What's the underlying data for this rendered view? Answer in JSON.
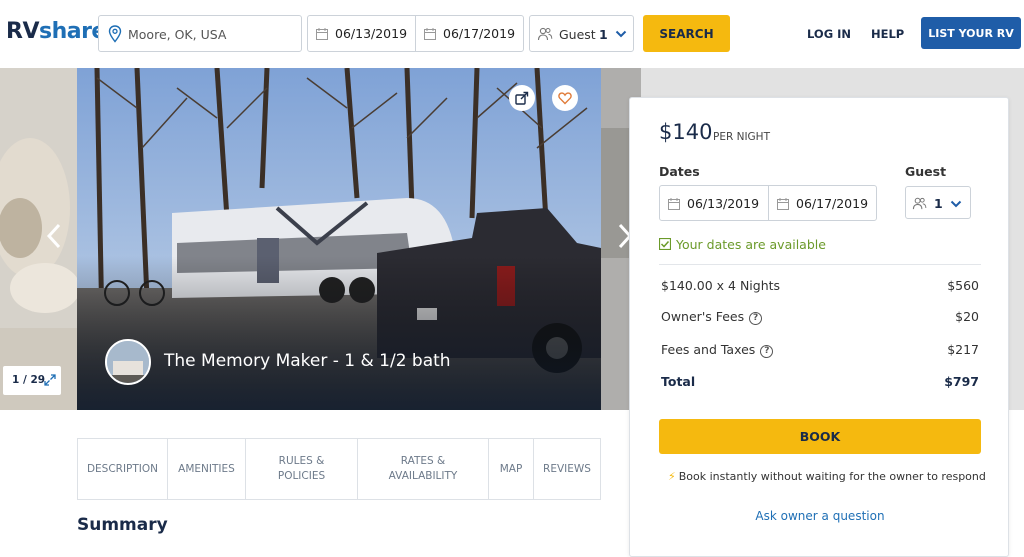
{
  "header": {
    "logo_rv": "RV",
    "logo_share": "share",
    "location_value": "Moore, OK, USA",
    "start_date": "06/13/2019",
    "end_date": "06/17/2019",
    "guest_label": "Guest",
    "guest_count": "1",
    "search_label": "SEARCH",
    "login_label": "LOG IN",
    "help_label": "HELP",
    "list_rv_label": "LIST YOUR RV"
  },
  "gallery": {
    "title": "The Memory Maker - 1 & 1/2 bath",
    "counter": "1 / 29"
  },
  "tabs": [
    {
      "label": "DESCRIPTION"
    },
    {
      "label": "AMENITIES"
    },
    {
      "label": "RULES &\nPOLICIES"
    },
    {
      "label": "RATES &\nAVAILABILITY"
    },
    {
      "label": "MAP"
    },
    {
      "label": "REVIEWS"
    }
  ],
  "summary_heading": "Summary",
  "booking": {
    "price": "$140",
    "per_night": "PER NIGHT",
    "dates_label": "Dates",
    "guest_label": "Guest",
    "start_date": "06/13/2019",
    "end_date": "06/17/2019",
    "guest_count": "1",
    "availability": "Your dates are available",
    "lines": [
      {
        "label": "$140.00 x 4 Nights",
        "value": "$560",
        "help": false
      },
      {
        "label": "Owner's Fees",
        "value": "$20",
        "help": true
      },
      {
        "label": "Fees and Taxes",
        "value": "$217",
        "help": true
      }
    ],
    "total_label": "Total",
    "total_value": "$797",
    "book_label": "BOOK",
    "instant_text": "Book instantly without waiting for the owner to respond",
    "ask_owner": "Ask owner a question"
  },
  "colors": {
    "brand_navy": "#1a2b49",
    "brand_blue": "#1f6fb5",
    "accent_yellow": "#f5b90f",
    "available_green": "#6b9a2a"
  },
  "icons": [
    "map-pin-icon",
    "calendar-icon",
    "guests-icon",
    "chevron-down-icon",
    "share-icon",
    "heart-icon",
    "expand-icon",
    "check-icon",
    "help-icon",
    "lightning-icon",
    "arrow-left-icon",
    "arrow-right-icon"
  ]
}
